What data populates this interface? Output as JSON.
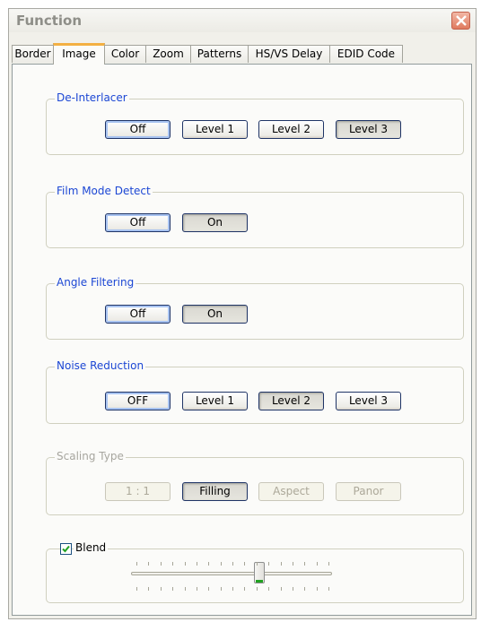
{
  "window": {
    "title": "Function"
  },
  "tabs": [
    "Border",
    "Image",
    "Color",
    "Zoom",
    "Patterns",
    "HS/VS Delay",
    "EDID Code"
  ],
  "active_tab": "Image",
  "groups": {
    "deinterlacer": {
      "label": "De-Interlacer",
      "buttons": [
        "Off",
        "Level 1",
        "Level 2",
        "Level 3"
      ],
      "selected": "Level 3"
    },
    "film_mode": {
      "label": "Film Mode Detect",
      "buttons": [
        "Off",
        "On"
      ],
      "selected": "On"
    },
    "angle_filtering": {
      "label": "Angle Filtering",
      "buttons": [
        "Off",
        "On"
      ],
      "selected": "On"
    },
    "noise_reduction": {
      "label": "Noise Reduction",
      "buttons": [
        "OFF",
        "Level 1",
        "Level 2",
        "Level 3"
      ],
      "selected": "Level 2"
    },
    "scaling_type": {
      "label": "Scaling Type",
      "buttons": [
        "1 : 1",
        "Filling",
        "Aspect",
        "Panor"
      ],
      "selected": "Filling",
      "disabled": true
    },
    "blend": {
      "label": "Blend",
      "checked": true,
      "slider_fraction": 0.64
    }
  },
  "colors": {
    "accent_tab": "#f3b043",
    "legend": "#1c47d4",
    "close": "#e07a5e"
  }
}
